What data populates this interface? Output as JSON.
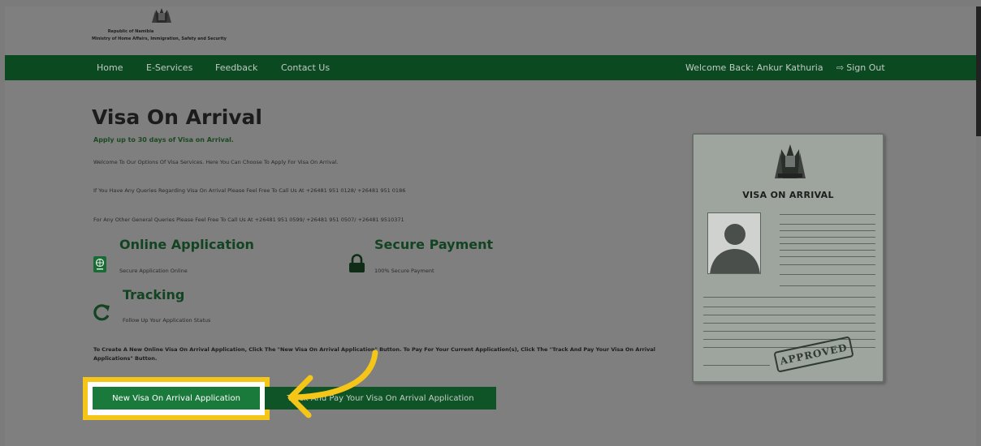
{
  "header": {
    "republic": "Republic of Namibia",
    "ministry": "Ministry of Home Affairs, Immigration, Safety and Security"
  },
  "nav": {
    "items": [
      {
        "label": "Home"
      },
      {
        "label": "E-Services"
      },
      {
        "label": "Feedback"
      },
      {
        "label": "Contact Us"
      }
    ],
    "welcome": "Welcome Back: Ankur Kathuria",
    "signout": "Sign Out"
  },
  "main": {
    "title": "Visa On Arrival",
    "subtitle": "Apply up to 30 days of Visa on Arrival.",
    "paragraphs": [
      "Welcome To Our Options Of Visa Services. Here You Can Choose To Apply For Visa On Arrival.",
      "If You Have Any Queries Regarding Visa On Arrival Please Feel Free To Call Us At +26481 951 0128/ +26481 951 0186",
      "For Any Other General Queries Please Feel Free To Call Us At +26481 951 0599/ +26481 951 0507/ +26481 9510371"
    ],
    "features": [
      {
        "title": "Online Application",
        "desc": "Secure Application Online",
        "icon": "passport-icon"
      },
      {
        "title": "Secure Payment",
        "desc": "100% Secure Payment",
        "icon": "lock-icon"
      },
      {
        "title": "Tracking",
        "desc": "Follow Up Your Application Status",
        "icon": "refresh-icon"
      }
    ],
    "instructions": "To Create A New Online Visa On Arrival Application, Click The \"New Visa On Arrival Application\" Button. To Pay For Your Current Application(s), Click The \"Track And Pay Your Visa On Arrival Applications\" Button.",
    "buttons": {
      "new_label": "New Visa On Arrival Application",
      "track_label": "Track And Pay Your Visa On Arrival Application"
    }
  },
  "visa_card": {
    "title": "VISA ON ARRIVAL",
    "stamp": "APPROVED"
  },
  "colors": {
    "nav_bg": "#0b4a21",
    "primary_button": "#1a7a3c",
    "highlight": "#f5c518",
    "heading_green": "#134422"
  }
}
